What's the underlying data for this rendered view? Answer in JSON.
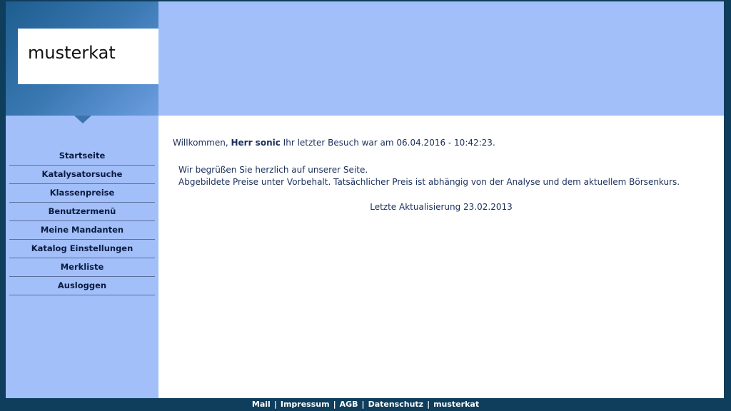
{
  "logo": {
    "text": "musterkat"
  },
  "nav": {
    "items": [
      {
        "label": "Startseite"
      },
      {
        "label": "Katalysatorsuche"
      },
      {
        "label": "Klassenpreise"
      },
      {
        "label": "Benutzermenü"
      },
      {
        "label": "Meine Mandanten"
      },
      {
        "label": "Katalog Einstellungen"
      },
      {
        "label": "Merkliste"
      },
      {
        "label": "Ausloggen"
      }
    ]
  },
  "content": {
    "welcome_prefix": "Willkommen,",
    "user_name": "Herr sonic",
    "last_visit_text": "Ihr letzter Besuch war am 06.04.2016 - 10:42:23.",
    "greeting": "Wir begrüßen Sie herzlich auf unserer Seite.",
    "disclaimer": "Abgebildete Preise unter Vorbehalt. Tatsächlicher Preis ist abhängig von der Analyse und dem aktuellem Börsenkurs.",
    "last_update": "Letzte Aktualisierung 23.02.2013"
  },
  "footer": {
    "links": [
      {
        "label": "Mail"
      },
      {
        "label": "Impressum"
      },
      {
        "label": "AGB"
      },
      {
        "label": "Datenschutz"
      },
      {
        "label": "musterkat"
      }
    ],
    "separator": "|"
  }
}
